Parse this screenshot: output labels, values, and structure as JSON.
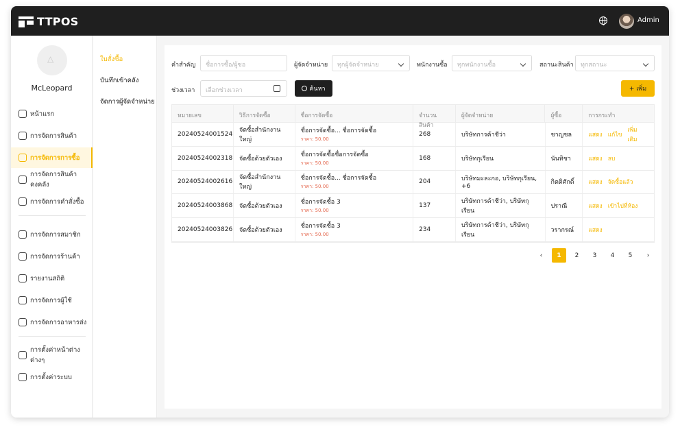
{
  "app": {
    "name": "TTPOS",
    "user": "Admin"
  },
  "profile": {
    "name": "McLeopard"
  },
  "sidebar": {
    "items": [
      {
        "label": "หน้าแรก",
        "icon": "home-icon"
      },
      {
        "label": "การจัดการสินค้า",
        "icon": "box-icon"
      },
      {
        "label": "การจัดการการซื้อ",
        "icon": "cart-icon",
        "active": true
      },
      {
        "label": "การจัดการสินค้าคงคลัง",
        "icon": "warehouse-icon"
      },
      {
        "label": "การจัดการคำสั่งซื้อ",
        "icon": "clipboard-icon"
      },
      {
        "label": "การจัดการสมาชิก",
        "icon": "member-icon"
      },
      {
        "label": "การจัดการร้านค้า",
        "icon": "store-icon"
      },
      {
        "label": "รายงานสถิติ",
        "icon": "report-icon"
      },
      {
        "label": "การจัดการผู้ใช้",
        "icon": "users-icon"
      },
      {
        "label": "การจัดการอาหารส่ง",
        "icon": "delivery-icon"
      },
      {
        "label": "การตั้งค่าหน้าต่างต่างๆ",
        "icon": "display-settings-icon"
      },
      {
        "label": "การตั้งค่าระบบ",
        "icon": "gear-icon"
      }
    ]
  },
  "subnav": {
    "items": [
      {
        "label": "ใบสั่งซื้อ",
        "active": true
      },
      {
        "label": "บันทึกเข้าคลัง"
      },
      {
        "label": "จัดการผู้จัดจำหน่าย"
      }
    ]
  },
  "filters": {
    "keyword": {
      "label": "คำสำคัญ",
      "placeholder": "ชื่อการซื้อ/ผู้ซอ"
    },
    "supplier": {
      "label": "ผู้จัดจำหน่าย",
      "placeholder": "ทุกผู้จัดจำหน่าย"
    },
    "buyer": {
      "label": "พนักงานซื้อ",
      "placeholder": "ทุกพนักงานซื้อ"
    },
    "status": {
      "label": "สถานะสินค้า",
      "placeholder": "ทุกสถานะ"
    },
    "period": {
      "label": "ช่วงเวลา",
      "placeholder": "เลือกช่วงเวลา"
    },
    "search_label": "ค้นหา",
    "add_label": "+ เพิ่ม"
  },
  "table": {
    "headers": [
      "หมายเลข",
      "วิธีการจัดซื้อ",
      "ชื่อการจัดซื้อ",
      "จำนวนสินค้า",
      "ผู้จัดจำหน่าย",
      "ผู้ซื้อ",
      "การกระทำ"
    ],
    "rows": [
      {
        "id": "20240524001524",
        "method": "จัดซื้อสำนักงานใหญ่",
        "name": "ชื่อการจัดซื้อ... ชื่อการจัดซื้อ",
        "price": "ราคา: 50.00",
        "qty": "268",
        "supplier": "บริษัทการค้าชีว่า",
        "buyer": "ชาญชล",
        "actions": [
          "แสดง",
          "แก้ไข",
          "เพิ่มเติม"
        ]
      },
      {
        "id": "20240524002318",
        "method": "จัดซื้อด้วยตัวเอง",
        "name": "ชื่อการจัดซื้อชื่อการจัดซื้อ",
        "price": "ราคา: 50.00",
        "qty": "168",
        "supplier": "บริษัทกุเรียน",
        "buyer": "นันทิชา",
        "actions": [
          "แสดง",
          "ลบ"
        ]
      },
      {
        "id": "20240524002616",
        "method": "จัดซื้อสำนักงานใหญ่",
        "name": "ชื่อการจัดซื้อ... ชื่อการจัดซื้อ",
        "price": "ราคา: 50.00",
        "qty": "204",
        "supplier": "บริษัทมะละกอ, บริษัทกุเรียน, +6",
        "buyer": "กิตติศักดิ์",
        "actions": [
          "แสดง",
          "จัดซื้อแล้ว"
        ]
      },
      {
        "id": "20240524003868",
        "method": "จัดซื้อด้วยตัวเอง",
        "name": "ชื่อการจัดซื้อ 3",
        "price": "ราคา: 50.00",
        "qty": "137",
        "supplier": "บริษัทการค้าชีว่า, บริษัทกุเรียน",
        "buyer": "ปราณี",
        "actions": [
          "แสดง",
          "เข้าไปที่ห้อง"
        ]
      },
      {
        "id": "20240524003826",
        "method": "จัดซื้อด้วยตัวเอง",
        "name": "ชื่อการจัดซื้อ 3",
        "price": "ราคา: 50.00",
        "qty": "234",
        "supplier": "บริษัทการค้าชีว่า, บริษัทกุเรียน",
        "buyer": "วรากรณ์",
        "actions": [
          "แสดง"
        ]
      }
    ]
  },
  "pagination": {
    "pages": [
      "1",
      "2",
      "3",
      "4",
      "5"
    ],
    "current": "1",
    "prev": "‹",
    "next": "›"
  },
  "colors": {
    "accent": "#f5b800",
    "topbar": "#1f1f1f",
    "price": "#e4684f"
  }
}
